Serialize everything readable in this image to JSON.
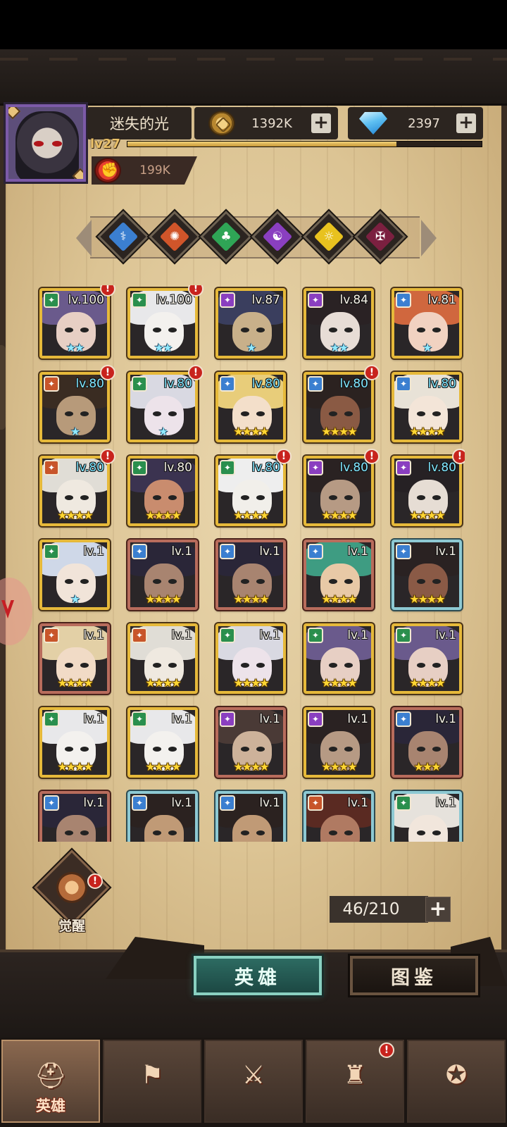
{
  "player": {
    "name": "迷失的光",
    "level_label": "lv27",
    "xp_fraction": 0.76,
    "power": "199K"
  },
  "resources": {
    "gold": "1392K",
    "gems": "2397"
  },
  "filters": [
    {
      "icon": "angel-wing-icon",
      "glyph": "⚕",
      "color": "#3b7fd0"
    },
    {
      "icon": "gear-sun-icon",
      "glyph": "✺",
      "color": "#d0552a"
    },
    {
      "icon": "clover-icon",
      "glyph": "♣",
      "color": "#2fa556"
    },
    {
      "icon": "purple-spiral-icon",
      "glyph": "☯",
      "color": "#8a3fc0"
    },
    {
      "icon": "radiant-eye-icon",
      "glyph": "☼",
      "color": "#e8c21f"
    },
    {
      "icon": "dark-demon-icon",
      "glyph": "✠",
      "color": "#7b2040"
    }
  ],
  "heroes": [
    {
      "lv": "lv.100",
      "stars": "★★",
      "starStyle": "light",
      "frame": "gold",
      "cls": "#2a8f4d",
      "alert": true,
      "hair": "#6a5a8c",
      "skin": "#e7cfc4"
    },
    {
      "lv": "lv.100",
      "stars": "★★",
      "starStyle": "light",
      "frame": "gold",
      "cls": "#2a8f4d",
      "alert": true,
      "hair": "#e8e8ea",
      "skin": "#f3f1ee"
    },
    {
      "lv": "lv.87",
      "stars": "★",
      "starStyle": "light",
      "frame": "gold",
      "cls": "#8a3fc0",
      "alert": false,
      "hair": "#3a3e5e",
      "skin": "#c8b08a"
    },
    {
      "lv": "lv.84",
      "stars": "★★",
      "starStyle": "light",
      "frame": "gold",
      "cls": "#8a3fc0",
      "alert": false,
      "hair": "#2a2224",
      "skin": "#e7ddd6"
    },
    {
      "lv": "lv.81",
      "stars": "★",
      "starStyle": "light",
      "frame": "gold",
      "cls": "#3b7fd0",
      "alert": false,
      "hair": "#d0673e",
      "skin": "#f1d2c1"
    },
    {
      "lv": "lv.80",
      "stars": "★",
      "starStyle": "light",
      "frame": "gold",
      "cls": "#c8552a",
      "alert": true,
      "hair": "#3a2c22",
      "skin": "#b79a7a",
      "cyan": true
    },
    {
      "lv": "lv.80",
      "stars": "★",
      "starStyle": "light",
      "frame": "gold",
      "cls": "#2a8f4d",
      "alert": true,
      "hair": "#d9d9e2",
      "skin": "#ede3ea",
      "cyan": true
    },
    {
      "lv": "lv.80",
      "stars": "★★★★",
      "starStyle": "gold",
      "frame": "gold",
      "cls": "#3b7fd0",
      "alert": false,
      "hair": "#e8cd7a",
      "skin": "#f3dfca",
      "cyan": true
    },
    {
      "lv": "lv.80",
      "stars": "★★★★",
      "starStyle": "gold",
      "frame": "gold",
      "cls": "#3b7fd0",
      "alert": true,
      "hair": "#2b2220",
      "skin": "#8a5a44",
      "cyan": true
    },
    {
      "lv": "lv.80",
      "stars": "★★★★",
      "starStyle": "gold",
      "frame": "gold",
      "cls": "#3b7fd0",
      "alert": false,
      "hair": "#e8e2d7",
      "skin": "#f3e5d8",
      "cyan": true
    },
    {
      "lv": "lv.80",
      "stars": "★★★★",
      "starStyle": "gold",
      "frame": "gold",
      "cls": "#c8552a",
      "alert": true,
      "hair": "#e0ddd6",
      "skin": "#efe9e0",
      "cyan": true
    },
    {
      "lv": "lv.80",
      "stars": "★★★★",
      "starStyle": "gold",
      "frame": "gold",
      "cls": "#2a8f4d",
      "alert": false,
      "hair": "#3b3350",
      "skin": "#c98c6e"
    },
    {
      "lv": "lv.80",
      "stars": "★★★★",
      "starStyle": "gold",
      "frame": "gold",
      "cls": "#2a8f4d",
      "alert": true,
      "hair": "#eeeeee",
      "skin": "#f1efea",
      "cyan": true
    },
    {
      "lv": "lv.80",
      "stars": "★★★★",
      "starStyle": "gold",
      "frame": "gold",
      "cls": "#8a3fc0",
      "alert": true,
      "hair": "#2a2222",
      "skin": "#b69a84",
      "cyan": true
    },
    {
      "lv": "lv.80",
      "stars": "★★★★",
      "starStyle": "gold",
      "frame": "gold",
      "cls": "#8a3fc0",
      "alert": true,
      "hair": "#262124",
      "skin": "#e6ddd4",
      "cyan": true
    },
    {
      "lv": "lv.1",
      "stars": "★",
      "starStyle": "light",
      "frame": "gold",
      "cls": "#2a8f4d",
      "alert": false,
      "hair": "#cfd8e8",
      "skin": "#f1e4d9"
    },
    {
      "lv": "lv.1",
      "stars": "★★★★",
      "starStyle": "gold",
      "frame": "red",
      "cls": "#3b7fd0",
      "alert": false,
      "hair": "#2a2638",
      "skin": "#a88470"
    },
    {
      "lv": "lv.1",
      "stars": "★★★★",
      "starStyle": "gold",
      "frame": "red",
      "cls": "#3b7fd0",
      "alert": false,
      "hair": "#2a2638",
      "skin": "#a88470"
    },
    {
      "lv": "lv.1",
      "stars": "★★★★",
      "starStyle": "gold",
      "frame": "red",
      "cls": "#3b7fd0",
      "alert": false,
      "hair": "#3e9c82",
      "skin": "#e8c9a6"
    },
    {
      "lv": "lv.1",
      "stars": "★★★★",
      "starStyle": "gold",
      "frame": "blue",
      "cls": "#3b7fd0",
      "alert": false,
      "hair": "#2a2222",
      "skin": "#8a5a46"
    },
    {
      "lv": "lv.1",
      "stars": "★★★★",
      "starStyle": "gold",
      "frame": "red",
      "cls": "#c8552a",
      "alert": false,
      "hair": "#e3d0a6",
      "skin": "#f1dbc6"
    },
    {
      "lv": "lv.1",
      "stars": "★★★★",
      "starStyle": "gold",
      "frame": "gold",
      "cls": "#c8552a",
      "alert": false,
      "hair": "#e0ddd6",
      "skin": "#efe9e0"
    },
    {
      "lv": "lv.1",
      "stars": "★★★★",
      "starStyle": "gold",
      "frame": "gold",
      "cls": "#2a8f4d",
      "alert": false,
      "hair": "#d9d9e2",
      "skin": "#ede3ea"
    },
    {
      "lv": "lv.1",
      "stars": "★★★★",
      "starStyle": "gold",
      "frame": "gold",
      "cls": "#2a8f4d",
      "alert": false,
      "hair": "#6a5a8c",
      "skin": "#e7cfc4"
    },
    {
      "lv": "lv.1",
      "stars": "★★★★",
      "starStyle": "gold",
      "frame": "gold",
      "cls": "#2a8f4d",
      "alert": false,
      "hair": "#6a5a8c",
      "skin": "#e7cfc4"
    },
    {
      "lv": "lv.1",
      "stars": "★★★★",
      "starStyle": "gold",
      "frame": "gold",
      "cls": "#2a8f4d",
      "alert": false,
      "hair": "#e8e8ea",
      "skin": "#f3f1ee"
    },
    {
      "lv": "lv.1",
      "stars": "★★★★",
      "starStyle": "gold",
      "frame": "gold",
      "cls": "#2a8f4d",
      "alert": false,
      "hair": "#e8e8ea",
      "skin": "#f3f1ee"
    },
    {
      "lv": "lv.1",
      "stars": "★★★★",
      "starStyle": "gold",
      "frame": "red",
      "cls": "#8a3fc0",
      "alert": false,
      "hair": "#4a3a36",
      "skin": "#cdb29a"
    },
    {
      "lv": "lv.1",
      "stars": "★★★★",
      "starStyle": "gold",
      "frame": "gold",
      "cls": "#8a3fc0",
      "alert": false,
      "hair": "#2a2222",
      "skin": "#b69a84"
    },
    {
      "lv": "lv.1",
      "stars": "★★★",
      "starStyle": "gold",
      "frame": "red",
      "cls": "#3b7fd0",
      "alert": false,
      "hair": "#2a2638",
      "skin": "#a88470"
    },
    {
      "lv": "lv.1",
      "stars": "",
      "starStyle": "gold",
      "frame": "red",
      "cls": "#3b7fd0",
      "alert": false,
      "hair": "#2a2638",
      "skin": "#a88470"
    },
    {
      "lv": "lv.1",
      "stars": "",
      "starStyle": "gold",
      "frame": "blue",
      "cls": "#3b7fd0",
      "alert": false,
      "hair": "#2b2220",
      "skin": "#c09a76"
    },
    {
      "lv": "lv.1",
      "stars": "",
      "starStyle": "gold",
      "frame": "blue",
      "cls": "#3b7fd0",
      "alert": false,
      "hair": "#2b2220",
      "skin": "#c09a76"
    },
    {
      "lv": "lv.1",
      "stars": "",
      "starStyle": "gold",
      "frame": "blue",
      "cls": "#c8552a",
      "alert": false,
      "hair": "#5a2a22",
      "skin": "#b07a62"
    },
    {
      "lv": "lv.1",
      "stars": "",
      "starStyle": "gold",
      "frame": "blue",
      "cls": "#2a8f4d",
      "alert": false,
      "hair": "#e6e2dc",
      "skin": "#f1e6dc"
    }
  ],
  "awaken": {
    "label": "觉醒"
  },
  "hero_count": "46/210",
  "tabs": {
    "heroes": "英雄",
    "guide": "图鉴"
  },
  "nav": [
    {
      "label": "英雄",
      "icon": "hero-helmet-icon",
      "glyph": "⛑",
      "active": true
    },
    {
      "label": "",
      "icon": "adventure-flag-icon",
      "glyph": "⚑",
      "active": false
    },
    {
      "label": "",
      "icon": "battle-swords-icon",
      "glyph": "⚔",
      "active": false
    },
    {
      "label": "",
      "icon": "castle-tower-icon",
      "glyph": "♜",
      "active": false,
      "alert": true
    },
    {
      "label": "",
      "icon": "guild-handshake-icon",
      "glyph": "✪",
      "active": false
    }
  ]
}
